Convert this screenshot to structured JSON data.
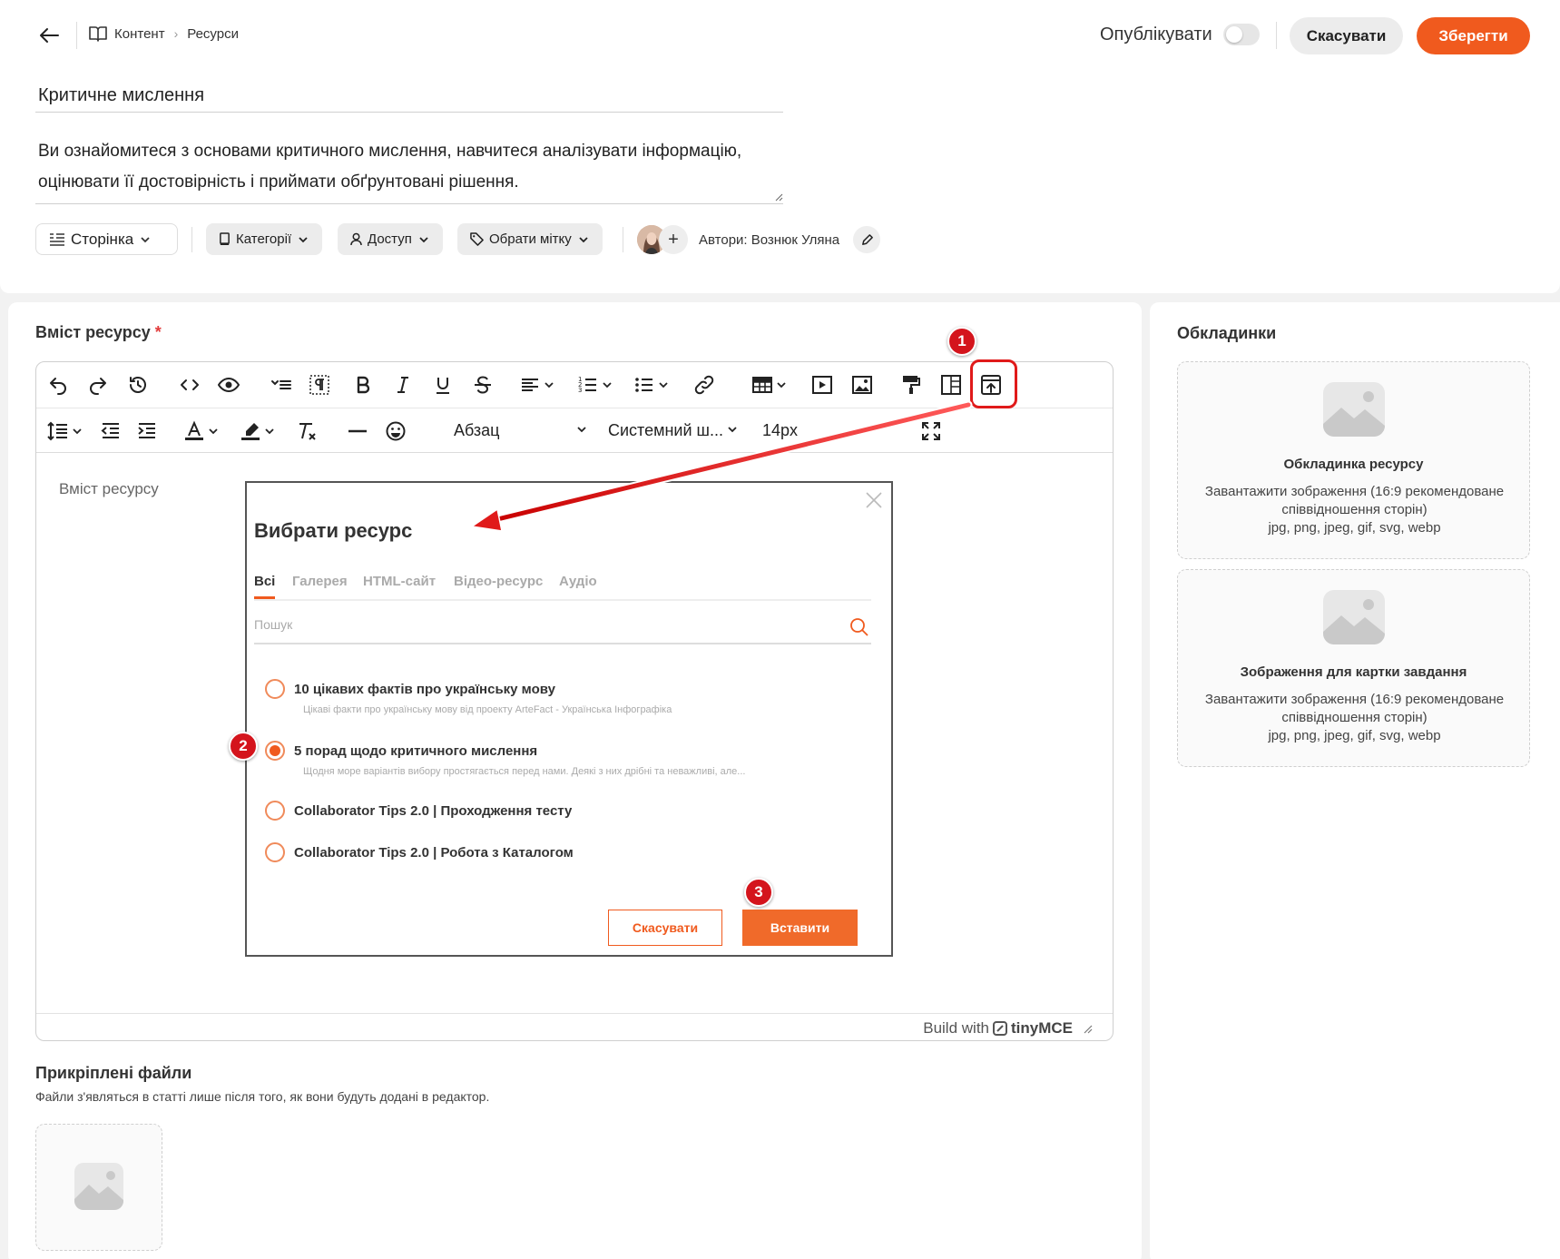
{
  "header": {
    "breadcrumb": [
      "Контент",
      "Ресурси"
    ],
    "publish_label": "Опублікувати",
    "cancel_label": "Скасувати",
    "save_label": "Зберегти"
  },
  "resource": {
    "title": "Критичне мислення",
    "description_line1": "Ви ознайомитеся з основами критичного мислення, навчитеся аналізувати інформацію,",
    "description_line2": "оцінювати її достовірність і приймати обґрунтовані рішення."
  },
  "meta": {
    "page_type": "Сторінка",
    "categories": "Категорії",
    "access": "Доступ",
    "tag": "Обрати мітку",
    "authors": "Автори: Вознюк Уляна"
  },
  "content_section": {
    "label": "Вміст ресурсу",
    "required_mark": "*",
    "placeholder": "Вміст ресурсу",
    "block_format": "Абзац",
    "font_family": "Системний ш...",
    "font_size": "14px",
    "brand_prefix": "Build with",
    "brand_name": "tinyMCE"
  },
  "modal": {
    "title": "Вибрати ресурс",
    "tabs": [
      "Всі",
      "Галерея",
      "HTML-сайт",
      "Відео-ресурс",
      "Аудіо"
    ],
    "active_tab": "Всі",
    "search_placeholder": "Пошук",
    "items": [
      {
        "title": "10 цікавих фактів про українську мову",
        "desc": "Цікаві факти про українську мову від проекту ArteFact - Українська Інфографіка",
        "selected": false
      },
      {
        "title": "5 порад щодо критичного мислення",
        "desc": "Щодня море варіантів вибору простягається перед нами. Деякі з них дрібні та неважливі, але...",
        "selected": true
      },
      {
        "title": "Collaborator Tips 2.0 | Проходження тесту",
        "desc": "",
        "selected": false
      },
      {
        "title": "Collaborator Tips 2.0 | Робота з Каталогом",
        "desc": "",
        "selected": false
      }
    ],
    "cancel_label": "Скасувати",
    "insert_label": "Вставити"
  },
  "annotations": {
    "step1": "1",
    "step2": "2",
    "step3": "3",
    "highlight_color": "#e01a1a"
  },
  "covers": {
    "section_label": "Обкладинки",
    "items": [
      {
        "title": "Обкладинка ресурсу",
        "sub1": "Завантажити зображення (16:9 рекомендоване",
        "sub2": "співвідношення сторін)",
        "sub3": "jpg, png, jpeg, gif, svg, webp"
      },
      {
        "title": "Зображення для картки завдання",
        "sub1": "Завантажити зображення (16:9 рекомендоване",
        "sub2": "співвідношення сторін)",
        "sub3": "jpg, png, jpeg, gif, svg, webp"
      }
    ]
  },
  "attachments": {
    "label": "Прикріплені файли",
    "sub": "Файли з'являться в статті лише після того, як вони будуть додані в редактор."
  },
  "colors": {
    "accent": "#f05a1e",
    "badge": "#d4141c"
  }
}
